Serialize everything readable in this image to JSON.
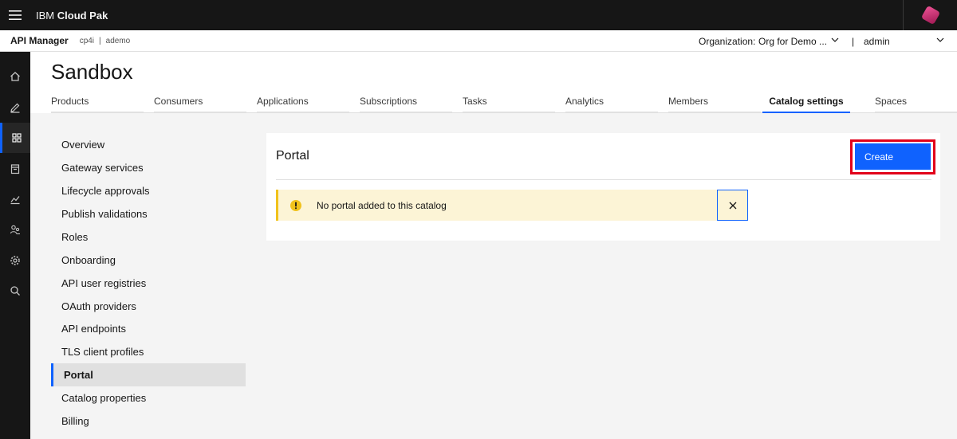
{
  "header": {
    "brand_prefix": "IBM",
    "brand_name": "Cloud Pak"
  },
  "subheader": {
    "app_name": "API Manager",
    "crumb_1": "cp4i",
    "crumb_sep": "|",
    "crumb_2": "ademo",
    "org_label": "Organization:",
    "org_value": "Org for Demo ...",
    "user_sep": "|",
    "user_name": "admin"
  },
  "rail": {
    "items": [
      "home-icon",
      "edit-icon",
      "dashboard-icon",
      "catalog-icon",
      "analytics-icon",
      "members-icon",
      "settings-icon",
      "search-icon"
    ],
    "active_index": 2
  },
  "page": {
    "title": "Sandbox"
  },
  "tabs": [
    {
      "label": "Products"
    },
    {
      "label": "Consumers"
    },
    {
      "label": "Applications"
    },
    {
      "label": "Subscriptions"
    },
    {
      "label": "Tasks"
    },
    {
      "label": "Analytics"
    },
    {
      "label": "Members"
    },
    {
      "label": "Catalog settings",
      "selected": true
    },
    {
      "label": "Spaces"
    }
  ],
  "settings_nav": [
    {
      "label": "Overview"
    },
    {
      "label": "Gateway services"
    },
    {
      "label": "Lifecycle approvals"
    },
    {
      "label": "Publish validations"
    },
    {
      "label": "Roles"
    },
    {
      "label": "Onboarding"
    },
    {
      "label": "API user registries"
    },
    {
      "label": "OAuth providers"
    },
    {
      "label": "API endpoints"
    },
    {
      "label": "TLS client profiles"
    },
    {
      "label": "Portal",
      "active": true
    },
    {
      "label": "Catalog properties"
    },
    {
      "label": "Billing"
    }
  ],
  "portal": {
    "title": "Portal",
    "create_label": "Create",
    "notice_text": "No portal added to this catalog"
  },
  "colors": {
    "accent": "#0f62fe",
    "warning": "#f1c21b",
    "highlight": "#e2001a",
    "topbar": "#161616"
  }
}
